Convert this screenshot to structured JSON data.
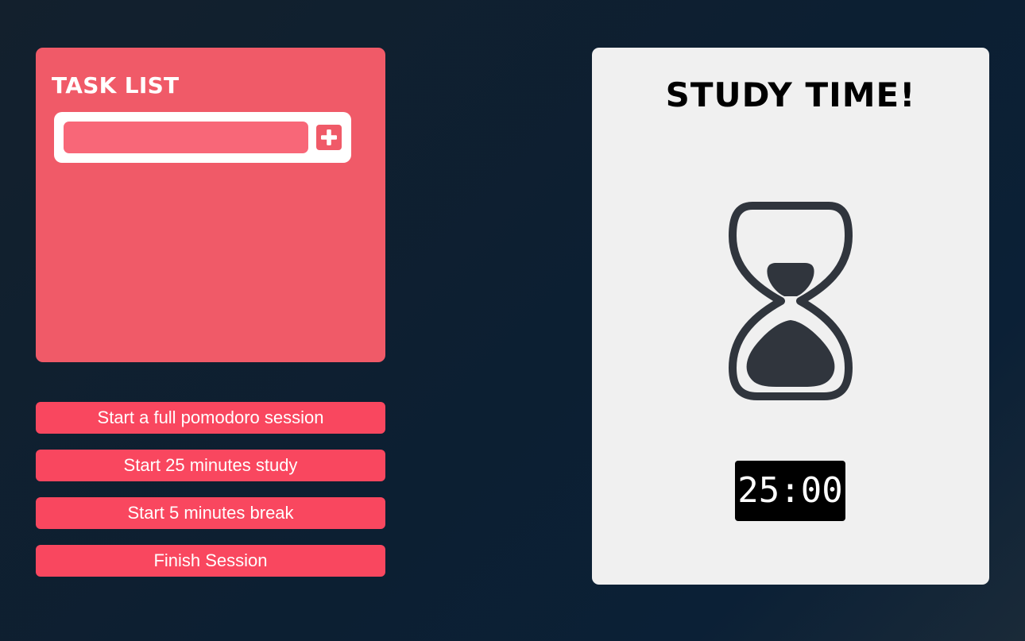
{
  "task_list": {
    "title": "TASK LIST",
    "input": {
      "value": "",
      "placeholder": ""
    },
    "add_icon": "plus-icon"
  },
  "actions": [
    {
      "label": "Start a full pomodoro session"
    },
    {
      "label": "Start 25 minutes study"
    },
    {
      "label": "Start 5 minutes break"
    },
    {
      "label": "Finish Session"
    }
  ],
  "study": {
    "title": "STUDY TIME!",
    "icon": "hourglass-icon",
    "timer": "25:00"
  },
  "colors": {
    "panel_red": "#f05a68",
    "button_red": "#f9475f",
    "input_pink": "#f86778",
    "study_panel": "#f0f0f0",
    "hourglass": "#30353d",
    "background": "#0c1f32"
  }
}
